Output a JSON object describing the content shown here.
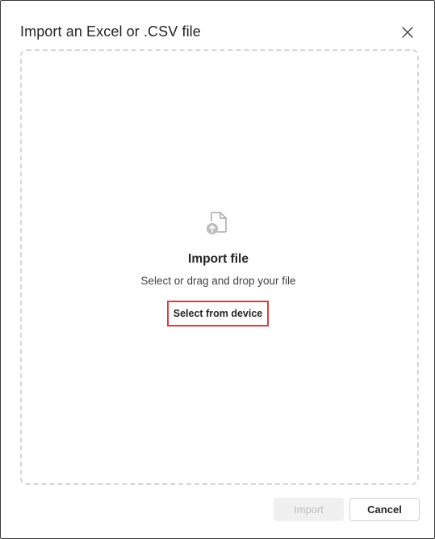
{
  "dialog": {
    "title": "Import an Excel or .CSV file",
    "close_icon": "close-icon"
  },
  "dropzone": {
    "icon": "file-upload-icon",
    "title": "Import file",
    "subtitle": "Select or drag and drop your file",
    "select_button_label": "Select from device",
    "highlight_color": "#e03b3b"
  },
  "footer": {
    "import_label": "Import",
    "import_disabled": true,
    "cancel_label": "Cancel"
  }
}
